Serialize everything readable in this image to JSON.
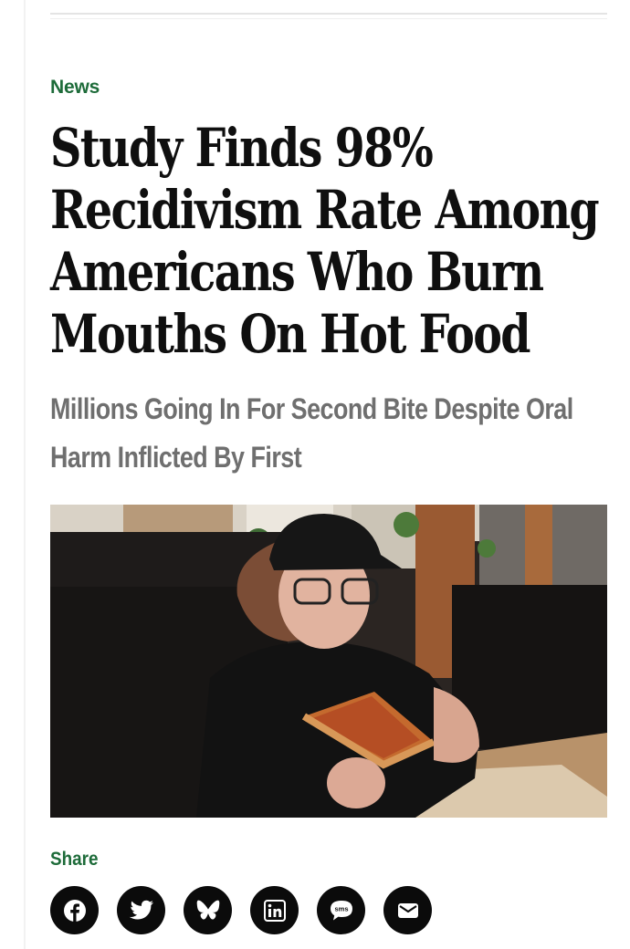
{
  "article": {
    "category": "News",
    "headline": "Study Finds 98% Recidivism Rate Among Americans Who Burn Mouths On Hot Food",
    "subhead": "Millions Going In For Second Bite Despite Oral Harm Inflicted By First"
  },
  "share": {
    "label": "Share",
    "buttons": [
      {
        "icon": "facebook-icon"
      },
      {
        "icon": "twitter-icon"
      },
      {
        "icon": "bluesky-icon"
      },
      {
        "icon": "linkedin-icon"
      },
      {
        "icon": "sms-icon",
        "glyph_text": "sms"
      },
      {
        "icon": "email-icon"
      }
    ]
  },
  "colors": {
    "accent_green": "#1d6b39",
    "subhead_gray": "#6f6f6f",
    "icon_bg": "#0b0b0b"
  }
}
